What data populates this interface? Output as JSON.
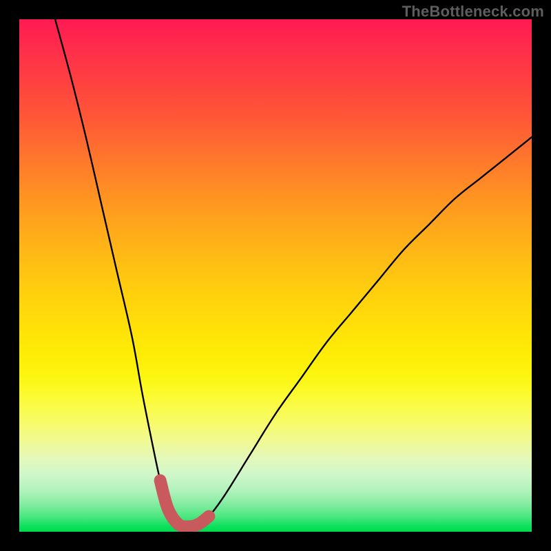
{
  "watermark": "TheBottleneck.com",
  "colors": {
    "background": "#000000",
    "curve_stroke": "#000000",
    "marker_stroke": "#c85a5d",
    "marker_fill": "#c85a5d"
  },
  "chart_data": {
    "type": "line",
    "title": "",
    "xlabel": "",
    "ylabel": "",
    "xlim": [
      0,
      100
    ],
    "ylim": [
      0,
      100
    ],
    "grid": false,
    "legend": false,
    "series": [
      {
        "name": "bottleneck-curve",
        "x": [
          7,
          10,
          13,
          16,
          19,
          22,
          24,
          26,
          27.5,
          29,
          31,
          33,
          35,
          37,
          40,
          45,
          50,
          55,
          60,
          65,
          70,
          75,
          80,
          85,
          90,
          95,
          100
        ],
        "values": [
          100,
          89,
          77,
          64,
          51,
          38,
          27,
          17,
          10,
          4.5,
          1.5,
          1,
          1.5,
          3,
          7,
          15,
          23,
          30,
          37,
          43,
          49,
          55,
          60,
          65,
          69,
          73,
          77
        ]
      }
    ],
    "markers": {
      "name": "highlighted-region",
      "x": [
        27.5,
        29,
        31,
        33,
        35,
        37
      ],
      "values": [
        10,
        4.5,
        1.5,
        1,
        1.5,
        3
      ]
    }
  }
}
